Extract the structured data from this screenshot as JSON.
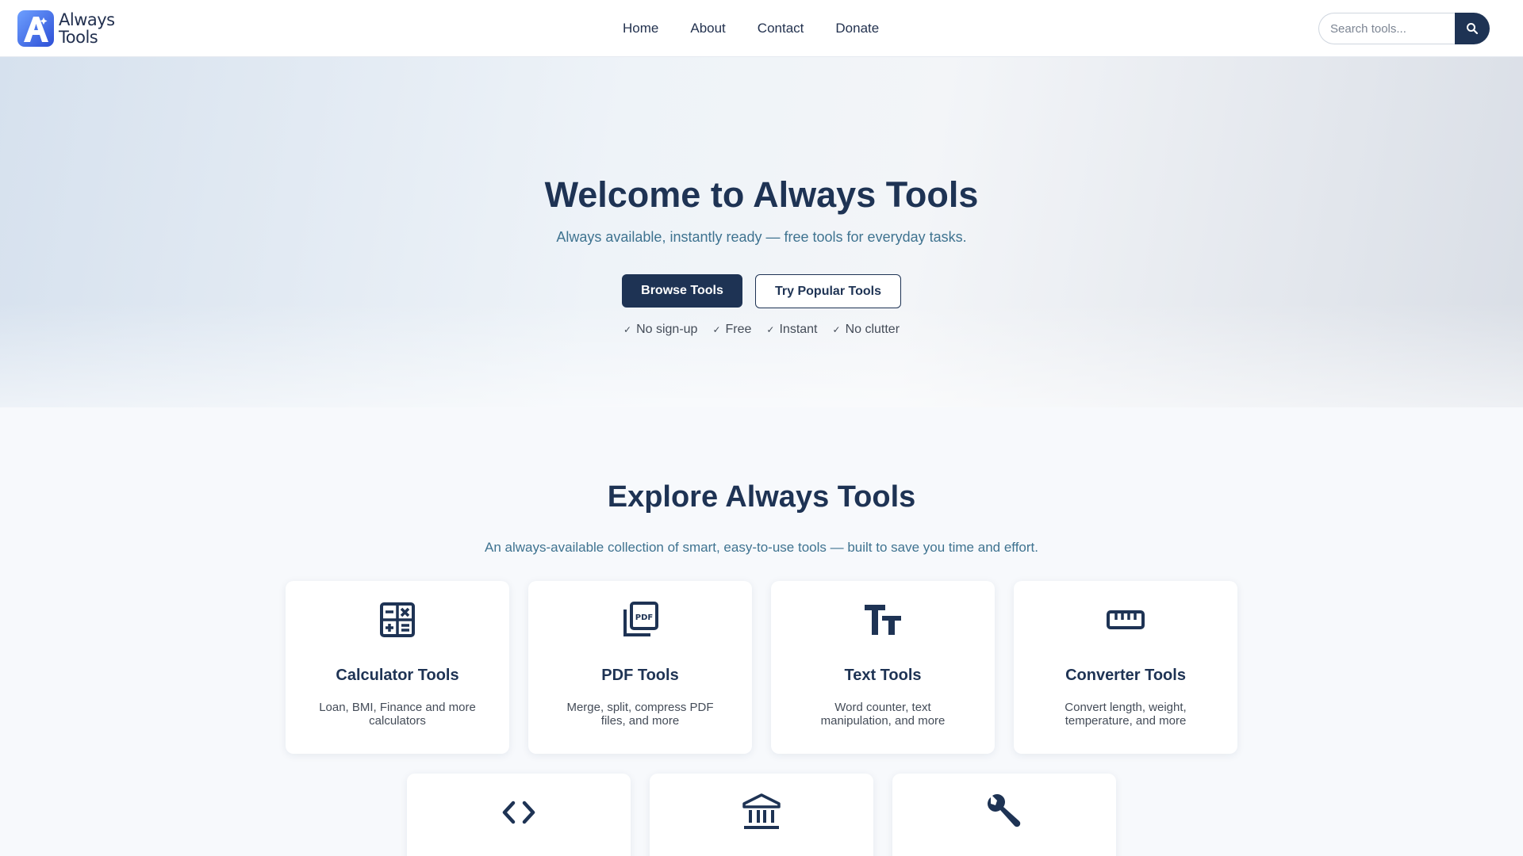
{
  "header": {
    "logo_line1": "Always",
    "logo_line2": "Tools",
    "nav": [
      "Home",
      "About",
      "Contact",
      "Donate"
    ],
    "search_placeholder": "Search tools..."
  },
  "hero": {
    "title": "Welcome to Always Tools",
    "subtitle": "Always available, instantly ready — free tools for everyday tasks.",
    "primary_button": "Browse Tools",
    "secondary_button": "Try Popular Tools",
    "perks": [
      "No sign-up",
      "Free",
      "Instant",
      "No clutter"
    ]
  },
  "explore": {
    "title": "Explore Always Tools",
    "subtitle": "An always-available collection of smart, easy-to-use tools — built to save you time and effort.",
    "cards": [
      {
        "icon": "calculator-icon",
        "title": "Calculator Tools",
        "desc": "Loan, BMI, Finance and more calculators"
      },
      {
        "icon": "pdf-icon",
        "title": "PDF Tools",
        "desc": "Merge, split, compress PDF files, and more"
      },
      {
        "icon": "text-icon",
        "title": "Text Tools",
        "desc": "Word counter, text manipulation, and more"
      },
      {
        "icon": "ruler-icon",
        "title": "Converter Tools",
        "desc": "Convert length, weight, temperature, and more"
      },
      {
        "icon": "code-icon",
        "title": "",
        "desc": ""
      },
      {
        "icon": "bank-icon",
        "title": "",
        "desc": ""
      },
      {
        "icon": "wrench-icon",
        "title": "",
        "desc": ""
      }
    ]
  },
  "colors": {
    "primary": "#1e3354",
    "accent_text": "#3f7390",
    "logo_blue": "#3b63e0"
  }
}
